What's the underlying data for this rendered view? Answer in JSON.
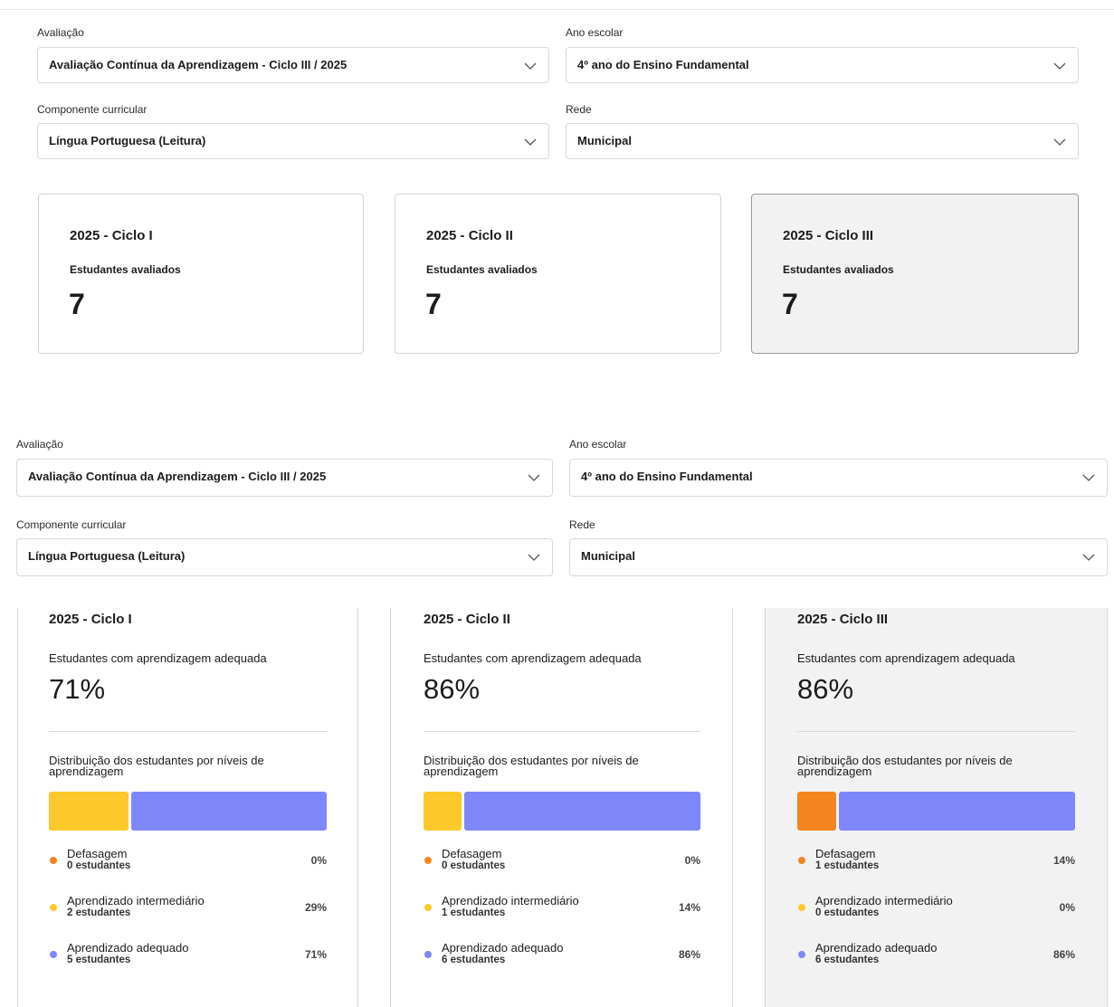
{
  "filters_top": {
    "avaliacao": {
      "label": "Avaliação",
      "value": "Avaliação Contínua da Aprendizagem - Ciclo III / 2025"
    },
    "ano_escolar": {
      "label": "Ano escolar",
      "value": "4º ano do Ensino Fundamental"
    },
    "componente": {
      "label": "Componente curricular",
      "value": "Língua Portuguesa (Leitura)"
    },
    "rede": {
      "label": "Rede",
      "value": "Municipal"
    }
  },
  "count_cards": [
    {
      "title": "2025 - Ciclo I",
      "subtitle": "Estudantes avaliados",
      "value": "7"
    },
    {
      "title": "2025 - Ciclo II",
      "subtitle": "Estudantes avaliados",
      "value": "7"
    },
    {
      "title": "2025 - Ciclo III",
      "subtitle": "Estudantes avaliados",
      "value": "7"
    }
  ],
  "filters_bottom": {
    "avaliacao": {
      "label": "Avaliação",
      "value": "Avaliação Contínua da Aprendizagem - Ciclo III / 2025"
    },
    "ano_escolar": {
      "label": "Ano escolar",
      "value": "4º ano do Ensino Fundamental"
    },
    "componente": {
      "label": "Componente curricular",
      "value": "Língua Portuguesa (Leitura)"
    },
    "rede": {
      "label": "Rede",
      "value": "Municipal"
    }
  },
  "colors": {
    "defasagem": "#f5861f",
    "intermediario": "#fdc92a",
    "adequado": "#7e87fa"
  },
  "dist_cards": [
    {
      "title": "2025 - Ciclo I",
      "subtitle": "Estudantes com aprendizagem adequada",
      "percent": "71%",
      "dist_title": "Distribuição dos estudantes por níveis de aprendizagem",
      "levels": [
        {
          "label": "Defasagem",
          "count": "0 estudantes",
          "pct": "0%",
          "value": 0
        },
        {
          "label": "Aprendizado intermediário",
          "count": "2 estudantes",
          "pct": "29%",
          "value": 29
        },
        {
          "label": "Aprendizado adequado",
          "count": "5 estudantes",
          "pct": "71%",
          "value": 71
        }
      ]
    },
    {
      "title": "2025 - Ciclo II",
      "subtitle": "Estudantes com aprendizagem adequada",
      "percent": "86%",
      "dist_title": "Distribuição dos estudantes por níveis de aprendizagem",
      "levels": [
        {
          "label": "Defasagem",
          "count": "0 estudantes",
          "pct": "0%",
          "value": 0
        },
        {
          "label": "Aprendizado intermediário",
          "count": "1 estudantes",
          "pct": "14%",
          "value": 14
        },
        {
          "label": "Aprendizado adequado",
          "count": "6 estudantes",
          "pct": "86%",
          "value": 86
        }
      ]
    },
    {
      "title": "2025 - Ciclo III",
      "subtitle": "Estudantes com aprendizagem adequada",
      "percent": "86%",
      "dist_title": "Distribuição dos estudantes por níveis de aprendizagem",
      "levels": [
        {
          "label": "Defasagem",
          "count": "1 estudantes",
          "pct": "14%",
          "value": 14
        },
        {
          "label": "Aprendizado intermediário",
          "count": "0 estudantes",
          "pct": "0%",
          "value": 0
        },
        {
          "label": "Aprendizado adequado",
          "count": "6 estudantes",
          "pct": "86%",
          "value": 86
        }
      ]
    }
  ]
}
